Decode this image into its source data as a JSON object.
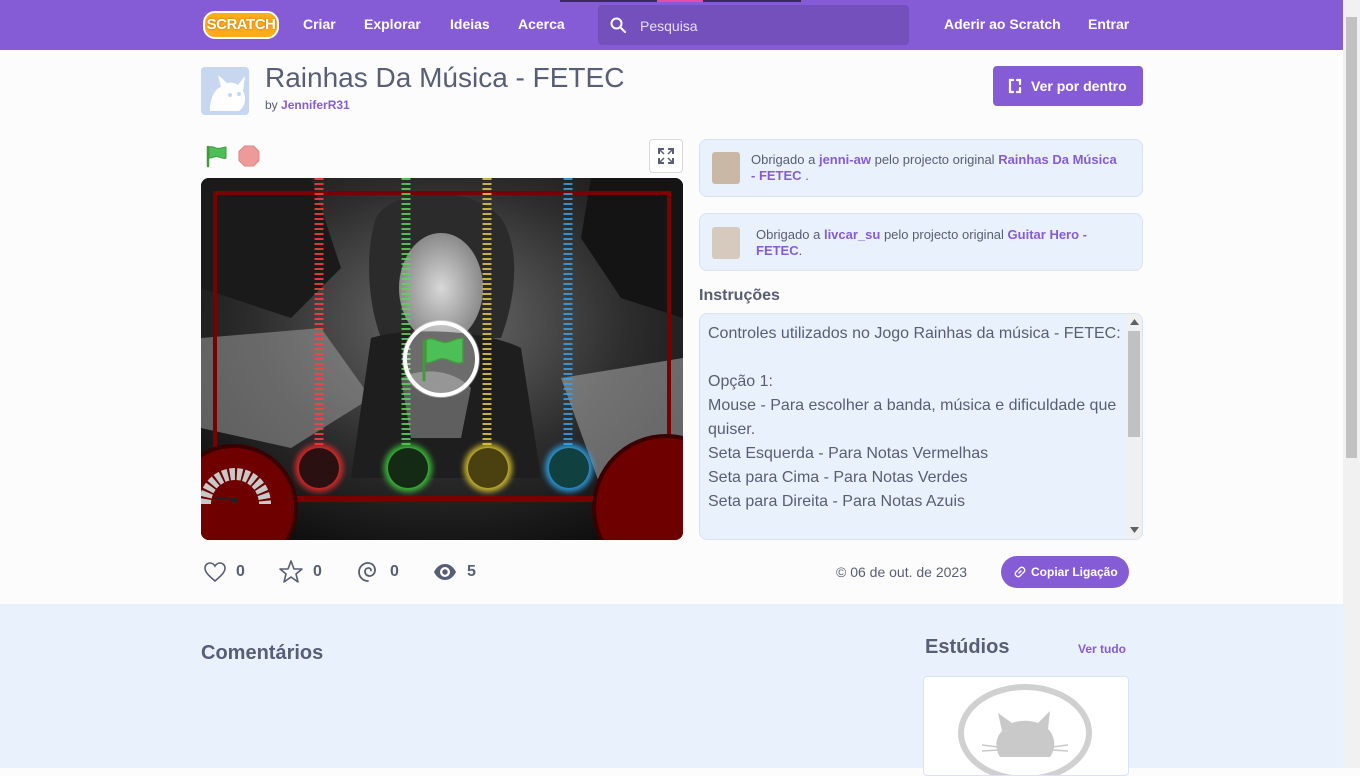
{
  "nav": {
    "logo": "SCRATCH",
    "create": "Criar",
    "explore": "Explorar",
    "ideas": "Ideias",
    "about": "Acerca",
    "search_placeholder": "Pesquisa",
    "join": "Aderir ao Scratch",
    "sign_in": "Entrar"
  },
  "project": {
    "title": "Rainhas Da Música - FETEC",
    "by_prefix": "by",
    "author": "JenniferR31",
    "see_inside": "Ver por dentro"
  },
  "credits": [
    {
      "prefix": "Obrigado a",
      "user": "jenni-aw",
      "middle": "pelo projecto original",
      "project": "Rainhas Da Música - FETEC",
      "suffix": "."
    },
    {
      "prefix": "Obrigado a",
      "user": "livcar_su",
      "middle": "pelo projecto original",
      "project": "Guitar Hero - FETEC",
      "suffix": "."
    }
  ],
  "instructions": {
    "heading": "Instruções",
    "text": "Controles utilizados no Jogo Rainhas da música - FETEC:\n\nOpção 1:\nMouse - Para escolher a banda, música e dificuldade que quiser.\nSeta Esquerda - Para Notas Vermelhas\nSeta para Cima - Para Notas Verdes\nSeta para Direita - Para Notas Azuis"
  },
  "stats": {
    "loves": "0",
    "favorites": "0",
    "remixes": "0",
    "views": "5"
  },
  "date": "© 06 de out. de 2023",
  "copy_link": "Copiar Ligação",
  "comments_heading": "Comentários",
  "studios": {
    "heading": "Estúdios",
    "see_all": "Ver tudo"
  },
  "colors": {
    "brand": "#855cd6",
    "green_flag": "#4cbf56",
    "stop": "#ec5959"
  }
}
